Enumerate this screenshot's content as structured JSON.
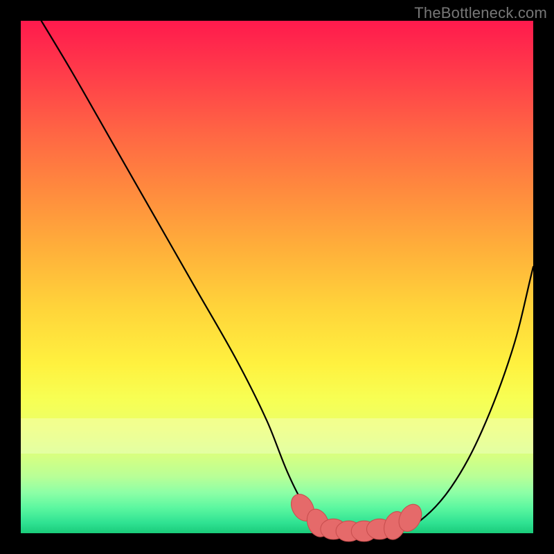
{
  "watermark": "TheBottleneck.com",
  "colors": {
    "curve": "#000000",
    "marker_fill": "#e56a6a",
    "marker_stroke": "#c94f4f",
    "background_black": "#000000"
  },
  "chart_data": {
    "type": "line",
    "title": "",
    "xlabel": "",
    "ylabel": "",
    "xlim": [
      0,
      100
    ],
    "ylim": [
      0,
      100
    ],
    "grid": false,
    "legend": false,
    "series": [
      {
        "name": "curve",
        "x": [
          4,
          10,
          18,
          26,
          34,
          42,
          48,
          52,
          55,
          58,
          61,
          64,
          67,
          70,
          73,
          78,
          84,
          90,
          96,
          100
        ],
        "y": [
          100,
          90,
          76,
          62,
          48,
          34,
          22,
          12,
          6,
          2,
          0.5,
          0,
          0,
          0,
          0.5,
          2.5,
          9,
          20,
          36,
          52
        ]
      }
    ],
    "markers": [
      {
        "x": 55,
        "y": 5,
        "rx": 2.0,
        "ry": 2.8,
        "angle": -30
      },
      {
        "x": 58,
        "y": 2,
        "rx": 2.0,
        "ry": 2.8,
        "angle": -22
      },
      {
        "x": 61,
        "y": 0.8,
        "rx": 2.5,
        "ry": 2.0,
        "angle": 0
      },
      {
        "x": 64,
        "y": 0.4,
        "rx": 2.5,
        "ry": 2.0,
        "angle": 0
      },
      {
        "x": 67,
        "y": 0.4,
        "rx": 2.5,
        "ry": 2.0,
        "angle": 0
      },
      {
        "x": 70,
        "y": 0.8,
        "rx": 2.5,
        "ry": 2.0,
        "angle": 0
      },
      {
        "x": 73,
        "y": 1.5,
        "rx": 2.0,
        "ry": 2.8,
        "angle": 20
      },
      {
        "x": 76,
        "y": 3.0,
        "rx": 2.0,
        "ry": 2.8,
        "angle": 28
      }
    ]
  }
}
